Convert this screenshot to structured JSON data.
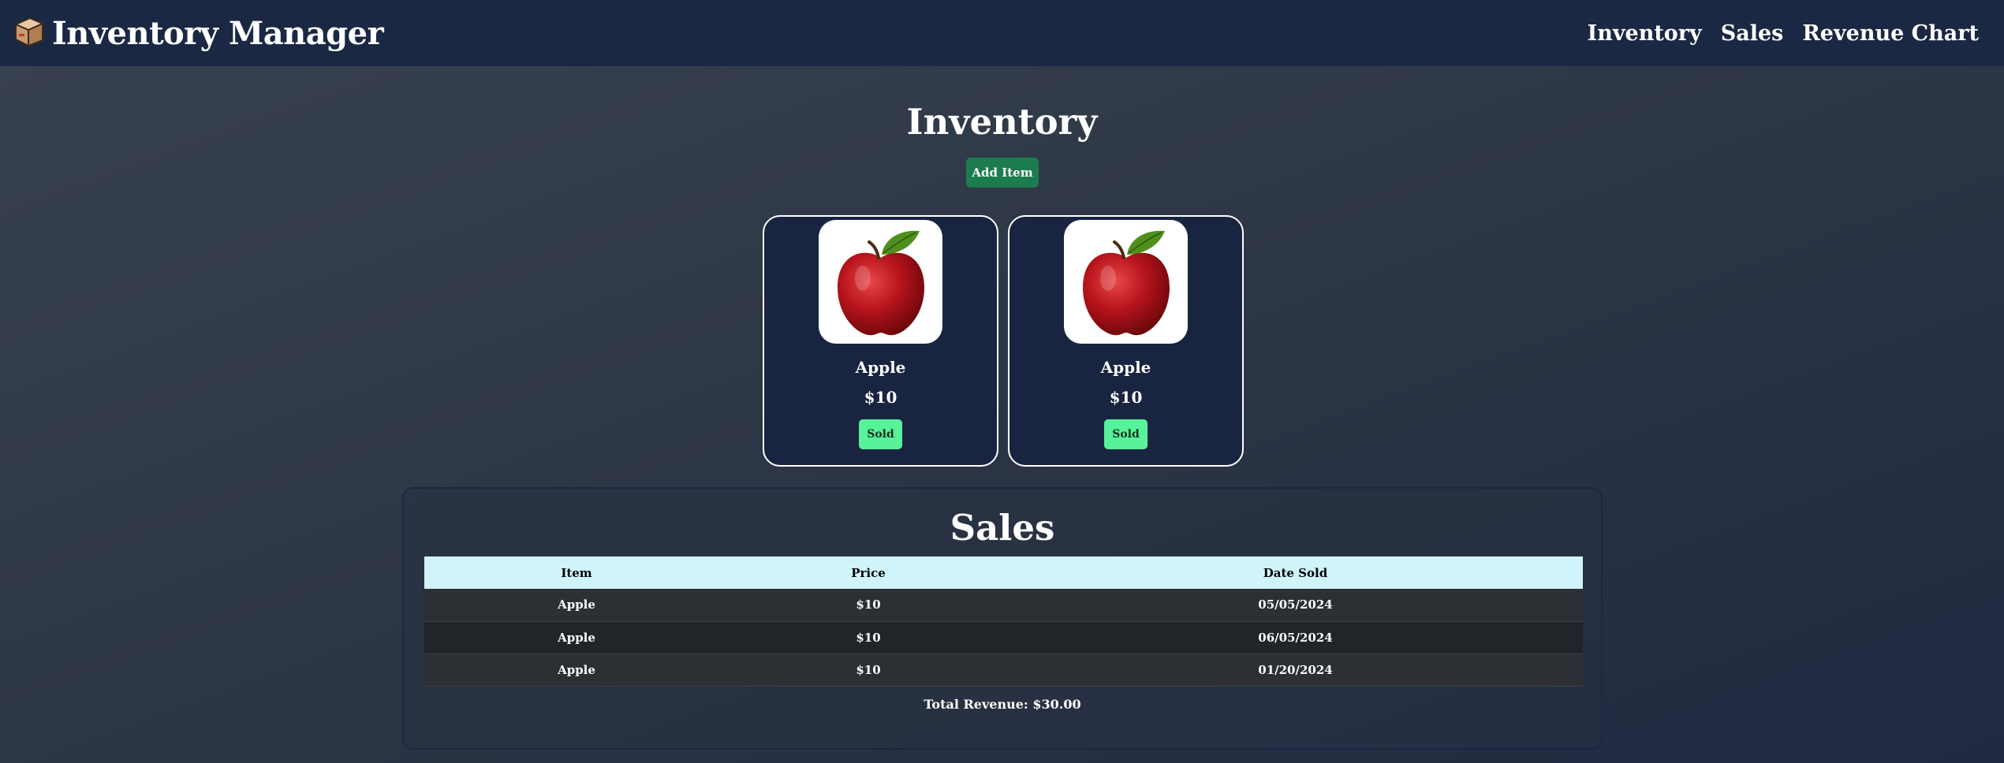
{
  "navbar": {
    "brand_title": "Inventory Manager",
    "brand_icon": "package-box-icon",
    "links": [
      "Inventory",
      "Sales",
      "Revenue Chart"
    ]
  },
  "inventory": {
    "title": "Inventory",
    "add_button_label": "Add Item",
    "items": [
      {
        "name": "Apple",
        "price": "$10",
        "sold_label": "Sold",
        "image": "red-apple"
      },
      {
        "name": "Apple",
        "price": "$10",
        "sold_label": "Sold",
        "image": "red-apple"
      }
    ]
  },
  "sales": {
    "title": "Sales",
    "columns": [
      "Item",
      "Price",
      "Date Sold"
    ],
    "rows": [
      {
        "item": "Apple",
        "price": "$10",
        "date": "05/05/2024"
      },
      {
        "item": "Apple",
        "price": "$10",
        "date": "06/05/2024"
      },
      {
        "item": "Apple",
        "price": "$10",
        "date": "01/20/2024"
      }
    ],
    "total_revenue": "Total Revenue: $30.00"
  },
  "colors": {
    "navbar_bg": "#1b2843",
    "add_button": "#1d7c4f",
    "sold_button": "#57f29a",
    "card_bg": "#182440",
    "table_header": "#cff4fc"
  }
}
